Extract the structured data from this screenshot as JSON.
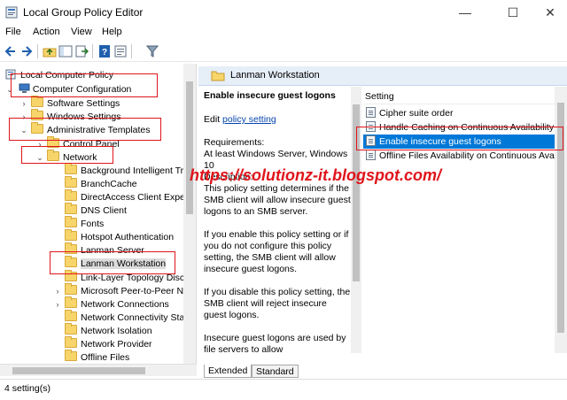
{
  "window": {
    "title": "Local Group Policy Editor",
    "controls": [
      "—",
      "☐",
      "✕"
    ]
  },
  "menu": [
    "File",
    "Action",
    "View",
    "Help"
  ],
  "toolbar": [
    "back-icon",
    "forward-icon",
    "up-folder-icon",
    "show-hide-tree-icon",
    "export-list-icon",
    "help-icon",
    "properties-icon",
    "filter-icon"
  ],
  "tree": {
    "items": [
      {
        "label": "Local Computer Policy",
        "expander": ""
      },
      {
        "label": "Computer Configuration",
        "expander": "⌄"
      },
      {
        "label": "Software Settings",
        "expander": "›"
      },
      {
        "label": "Windows Settings",
        "expander": "›"
      },
      {
        "label": "Administrative Templates",
        "expander": "⌄"
      },
      {
        "label": "Control Panel",
        "expander": "›"
      },
      {
        "label": "Network",
        "expander": "⌄"
      },
      {
        "label": "Background Intelligent Tra",
        "expander": ""
      },
      {
        "label": "BranchCache",
        "expander": ""
      },
      {
        "label": "DirectAccess Client Experie",
        "expander": ""
      },
      {
        "label": "DNS Client",
        "expander": ""
      },
      {
        "label": "Fonts",
        "expander": ""
      },
      {
        "label": "Hotspot Authentication",
        "expander": ""
      },
      {
        "label": "Lanman Server",
        "expander": ""
      },
      {
        "label": "Lanman Workstation",
        "expander": ""
      },
      {
        "label": "Link-Layer Topology Disco",
        "expander": ""
      },
      {
        "label": "Microsoft Peer-to-Peer Ne",
        "expander": "›"
      },
      {
        "label": "Network Connections",
        "expander": "›"
      },
      {
        "label": "Network Connectivity Stat",
        "expander": ""
      },
      {
        "label": "Network Isolation",
        "expander": ""
      },
      {
        "label": "Network Provider",
        "expander": ""
      },
      {
        "label": "Offline Files",
        "expander": ""
      }
    ],
    "selected": "Lanman Workstation"
  },
  "right": {
    "header": "Lanman Workstation",
    "description": {
      "title": "Enable insecure guest logons",
      "edit_prefix": "Edit ",
      "edit_link": "policy setting",
      "requirements_label": "Requirements:",
      "requirements": "At least Windows Server, Windows 10",
      "description_label": "Description:",
      "paragraphs": [
        "This policy setting determines if the SMB client will allow insecure guest logons to an SMB server.",
        "If you enable this policy setting or if you do not configure this policy setting, the SMB client will allow insecure guest logons.",
        "If you disable this policy setting, the SMB client will reject insecure guest logons.",
        "Insecure guest logons are used by file servers to allow"
      ]
    },
    "settings": {
      "column_header": "Setting",
      "items": [
        "Cipher suite order",
        "Handle Caching on Continuous Availability Sh",
        "Enable insecure guest logons",
        "Offline Files Availability on Continuous Availal"
      ],
      "selected": "Enable insecure guest logons"
    },
    "tabs": [
      "Extended",
      "Standard"
    ],
    "active_tab": "Extended"
  },
  "status": "4 setting(s)",
  "watermark": "https://solutionz-it.blogspot.com/",
  "colors": {
    "annotation_red": "#e0141b",
    "selection_blue": "#0078d7",
    "link_blue": "#0645ad",
    "folder_yellow": "#f7d56a"
  }
}
